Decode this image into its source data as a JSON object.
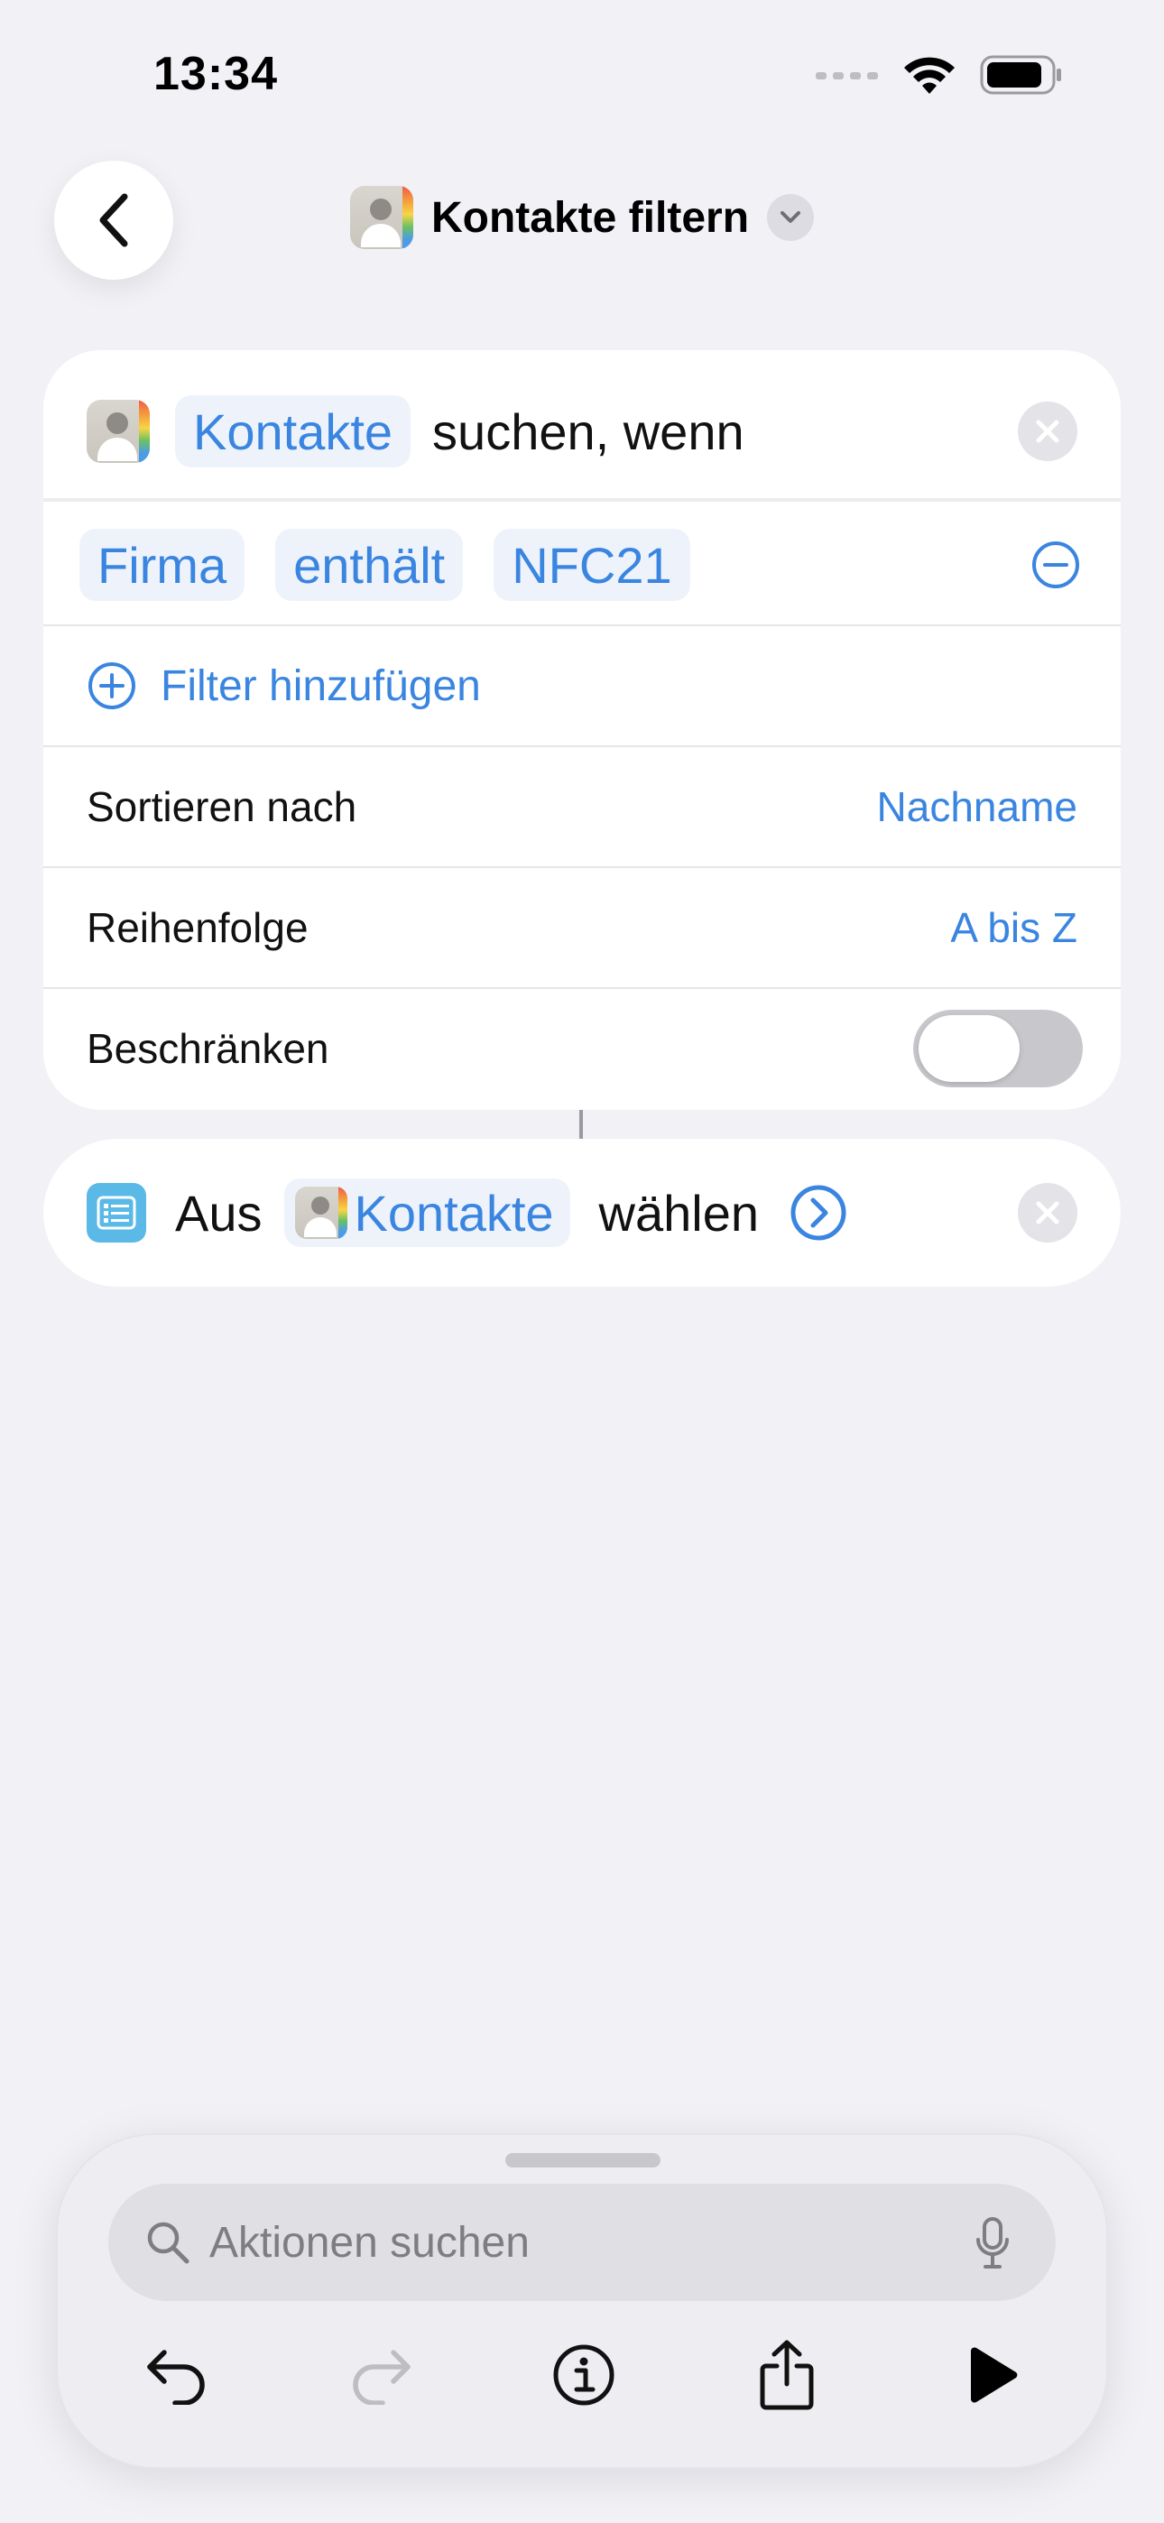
{
  "status": {
    "time": "13:34"
  },
  "header": {
    "title": "Kontakte filtern"
  },
  "action1": {
    "source_token": "Kontakte",
    "suffix": "suchen, wenn",
    "filter": {
      "field": "Firma",
      "operator": "enthält",
      "value": "NFC21"
    },
    "add_filter_label": "Filter hinzufügen",
    "sort_label": "Sortieren nach",
    "sort_value": "Nachname",
    "order_label": "Reihenfolge",
    "order_value": "A bis Z",
    "limit_label": "Beschränken",
    "limit_enabled": false
  },
  "action2": {
    "prefix": "Aus",
    "token": "Kontakte",
    "suffix": "wählen"
  },
  "bottom": {
    "search_placeholder": "Aktionen suchen"
  },
  "colors": {
    "accent": "#3a85e0",
    "background": "#f1f1f6"
  }
}
